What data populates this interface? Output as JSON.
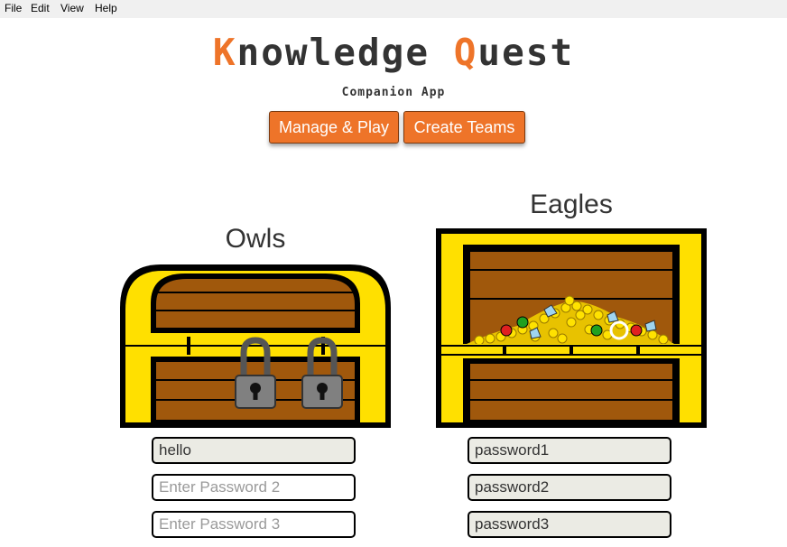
{
  "menu": [
    "File",
    "Edit",
    "View",
    "Help"
  ],
  "app": {
    "title_first_letter": "K",
    "title_first_rest": "nowledge",
    "title_second_letter": "Q",
    "title_second_rest": "uest",
    "subtitle": "Companion App"
  },
  "nav": {
    "manage_label": "Manage & Play",
    "create_label": "Create Teams"
  },
  "teams": [
    {
      "name": "Owls",
      "chest_state": "locked",
      "passwords": [
        {
          "value": "hello",
          "placeholder": ""
        },
        {
          "value": "",
          "placeholder": "Enter Password 2"
        },
        {
          "value": "",
          "placeholder": "Enter Password 3"
        }
      ]
    },
    {
      "name": "Eagles",
      "chest_state": "open",
      "passwords": [
        {
          "value": "password1",
          "placeholder": ""
        },
        {
          "value": "password2",
          "placeholder": ""
        },
        {
          "value": "password3",
          "placeholder": ""
        }
      ]
    }
  ],
  "colors": {
    "accent": "#ee7429",
    "gold": "#ffe000",
    "wood": "#a0580c",
    "lock": "#808080"
  }
}
